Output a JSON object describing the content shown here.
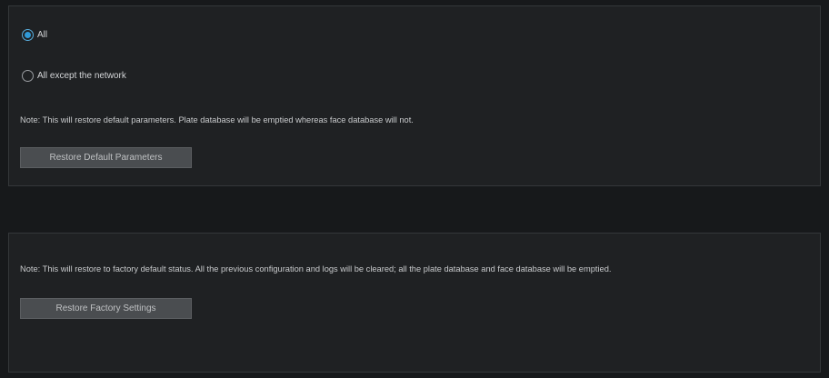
{
  "default_params": {
    "options": [
      {
        "label": "All",
        "checked": true
      },
      {
        "label": "All except the network",
        "checked": false
      }
    ],
    "note": "Note: This will restore default parameters. Plate database will be emptied whereas face database will not.",
    "button_label": "Restore Default Parameters"
  },
  "factory": {
    "note": "Note: This will restore to factory default status. All the previous configuration and logs will be cleared; all the plate database and face database will be emptied.",
    "button_label": "Restore Factory Settings"
  },
  "colors": {
    "background": "#17191b",
    "panel": "#1f2123",
    "accent": "#2f9ad8",
    "button": "#4a4d50"
  }
}
